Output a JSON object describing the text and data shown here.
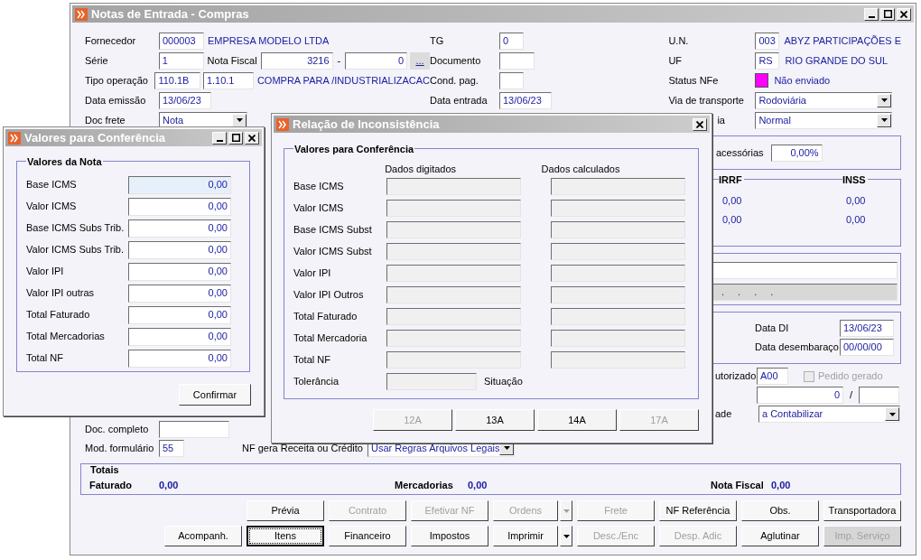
{
  "main_window": {
    "title": "Notas de Entrada - Compras"
  },
  "header": {
    "fornecedor": {
      "label": "Fornecedor",
      "code": "000003",
      "name": "EMPRESA MODELO LTDA"
    },
    "serie": {
      "label": "Série",
      "value": "1"
    },
    "nota_fiscal": {
      "label": "Nota Fiscal",
      "number": "3216",
      "separator": "-",
      "suffix": "0",
      "lookup": "..."
    },
    "tipo_operacao": {
      "label": "Tipo operação",
      "code": "110.1B",
      "cfop": "1.10.1",
      "description": "COMPRA PARA /INDUSTRIALIZACAC"
    },
    "data_emissao": {
      "label": "Data emissão",
      "value": "13/06/23"
    },
    "doc_frete": {
      "label": "Doc frete",
      "value": "Nota"
    },
    "tg": {
      "label": "TG",
      "value": "0"
    },
    "documento": {
      "label": "Documento"
    },
    "cond_pag": {
      "label": "Cond. pag."
    },
    "data_entrada": {
      "label": "Data entrada",
      "value": "13/06/23"
    },
    "un": {
      "label": "U.N.",
      "code": "003",
      "name": "ABYZ PARTICIPAÇÕES E"
    },
    "uf": {
      "label": "UF",
      "code": "RS",
      "name": "RIO GRANDE DO SUL"
    },
    "status_nfe": {
      "label": "Status NFe",
      "color": "#ff00ff",
      "text": "Não enviado"
    },
    "via_transporte": {
      "label": "Via de transporte",
      "value": "Rodoviária"
    },
    "row_5_right": {
      "label": "ia",
      "value": "Normal"
    }
  },
  "right_panel": {
    "acessorias": {
      "label": "acessórias",
      "value": "0,00%"
    },
    "retencoes": [
      {
        "heading": "IRRF",
        "values": [
          "0,00",
          "0,00"
        ]
      },
      {
        "heading": "INSS",
        "values": [
          "0,00",
          "0,00"
        ]
      }
    ],
    "masked_field": {
      "value": ". . . ."
    },
    "data_di": {
      "label": "Data DI",
      "value": "13/06/23"
    },
    "data_desembaraco": {
      "label": "Data desembaraço",
      "value": "00/00/00"
    },
    "autorizado": {
      "label": "utorizado",
      "value": "A00"
    },
    "pedido_gerado": {
      "label": "Pedido gerado",
      "checked": false,
      "disabled": true
    },
    "quantity": {
      "value": "0",
      "separator": "/"
    },
    "situacao": {
      "label": "ade",
      "value": "a Contabilizar"
    }
  },
  "lower_left": {
    "doc_completo": {
      "label": "Doc. completo"
    },
    "mod_formulario": {
      "label": "Mod. formulário",
      "value": "55"
    },
    "nf_gera": {
      "label": "NF gera Receita ou Crédito",
      "value": "Usar Regras Arquivos Legais"
    }
  },
  "totais": {
    "title": "Totais",
    "items": [
      {
        "label": "Faturado",
        "value": "0,00"
      },
      {
        "label": "Mercadorias",
        "value": "0,00"
      },
      {
        "label": "Nota Fiscal",
        "value": "0,00"
      }
    ]
  },
  "buttons_row_1": [
    {
      "label": "Prévia",
      "disabled": false,
      "default": false,
      "menu": false
    },
    {
      "label": "Contrato",
      "disabled": true,
      "default": false,
      "menu": false
    },
    {
      "label": "Efetivar NF",
      "disabled": true,
      "default": false,
      "menu": false
    },
    {
      "label": "Ordens",
      "disabled": true,
      "default": false,
      "menu": true
    },
    {
      "label": "Frete",
      "disabled": true,
      "default": false,
      "menu": false
    },
    {
      "label": "NF Referência",
      "disabled": false,
      "default": false,
      "menu": false
    },
    {
      "label": "Obs.",
      "disabled": false,
      "default": false,
      "menu": false
    },
    {
      "label": "Transportadora",
      "disabled": false,
      "default": false,
      "menu": false
    }
  ],
  "buttons_row_2": [
    {
      "label": "Acompanh.",
      "disabled": false,
      "default": false,
      "menu": false
    },
    {
      "label": "Itens",
      "disabled": false,
      "default": true,
      "menu": false
    },
    {
      "label": "Financeiro",
      "disabled": false,
      "default": false,
      "menu": false
    },
    {
      "label": "Impostos",
      "disabled": false,
      "default": false,
      "menu": false
    },
    {
      "label": "Imprimir",
      "disabled": false,
      "default": false,
      "menu": true
    },
    {
      "label": "Desc./Enc",
      "disabled": true,
      "default": false,
      "menu": false
    },
    {
      "label": "Desp. Adic",
      "disabled": true,
      "default": false,
      "menu": false
    },
    {
      "label": "Aglutinar",
      "disabled": false,
      "default": false,
      "menu": false
    },
    {
      "label": "Imp. Serviço",
      "disabled": true,
      "default": false,
      "menu": false
    }
  ],
  "dialog_valores": {
    "title": "Valores para Conferência",
    "group": "Valores da Nota",
    "confirm": "Confirmar",
    "rows": [
      {
        "label": "Base ICMS",
        "value": "0,00",
        "focused": true
      },
      {
        "label": "Valor ICMS",
        "value": "0,00",
        "focused": false
      },
      {
        "label": "Base ICMS Subs Trib.",
        "value": "0,00",
        "focused": false
      },
      {
        "label": "Valor ICMS Subs Trib.",
        "value": "0,00",
        "focused": false
      },
      {
        "label": "Valor IPI",
        "value": "0,00",
        "focused": false
      },
      {
        "label": "Valor IPI outras",
        "value": "0,00",
        "focused": false
      },
      {
        "label": "Total Faturado",
        "value": "0,00",
        "focused": false
      },
      {
        "label": "Total Mercadorias",
        "value": "0,00",
        "focused": false
      },
      {
        "label": "Total NF",
        "value": "0,00",
        "focused": false
      }
    ]
  },
  "dialog_inconsistencia": {
    "title": "Relação de Inconsistência",
    "group": "Valores para Conferência",
    "columns": [
      "Dados digitados",
      "Dados calculados"
    ],
    "rows": [
      {
        "label": "Base ICMS"
      },
      {
        "label": "Valor ICMS"
      },
      {
        "label": "Base ICMS Subst"
      },
      {
        "label": "Valor ICMS Subst"
      },
      {
        "label": "Valor IPI"
      },
      {
        "label": "Valor IPI Outros"
      },
      {
        "label": "Total Faturado"
      },
      {
        "label": "Total Mercadoria"
      },
      {
        "label": "Total NF"
      }
    ],
    "tolerance": {
      "label": "Tolerância",
      "status_label": "Situação"
    },
    "buttons": [
      {
        "label": "12A",
        "disabled": true
      },
      {
        "label": "13A",
        "disabled": false
      },
      {
        "label": "14A",
        "disabled": false
      },
      {
        "label": "17A",
        "disabled": true
      }
    ]
  }
}
